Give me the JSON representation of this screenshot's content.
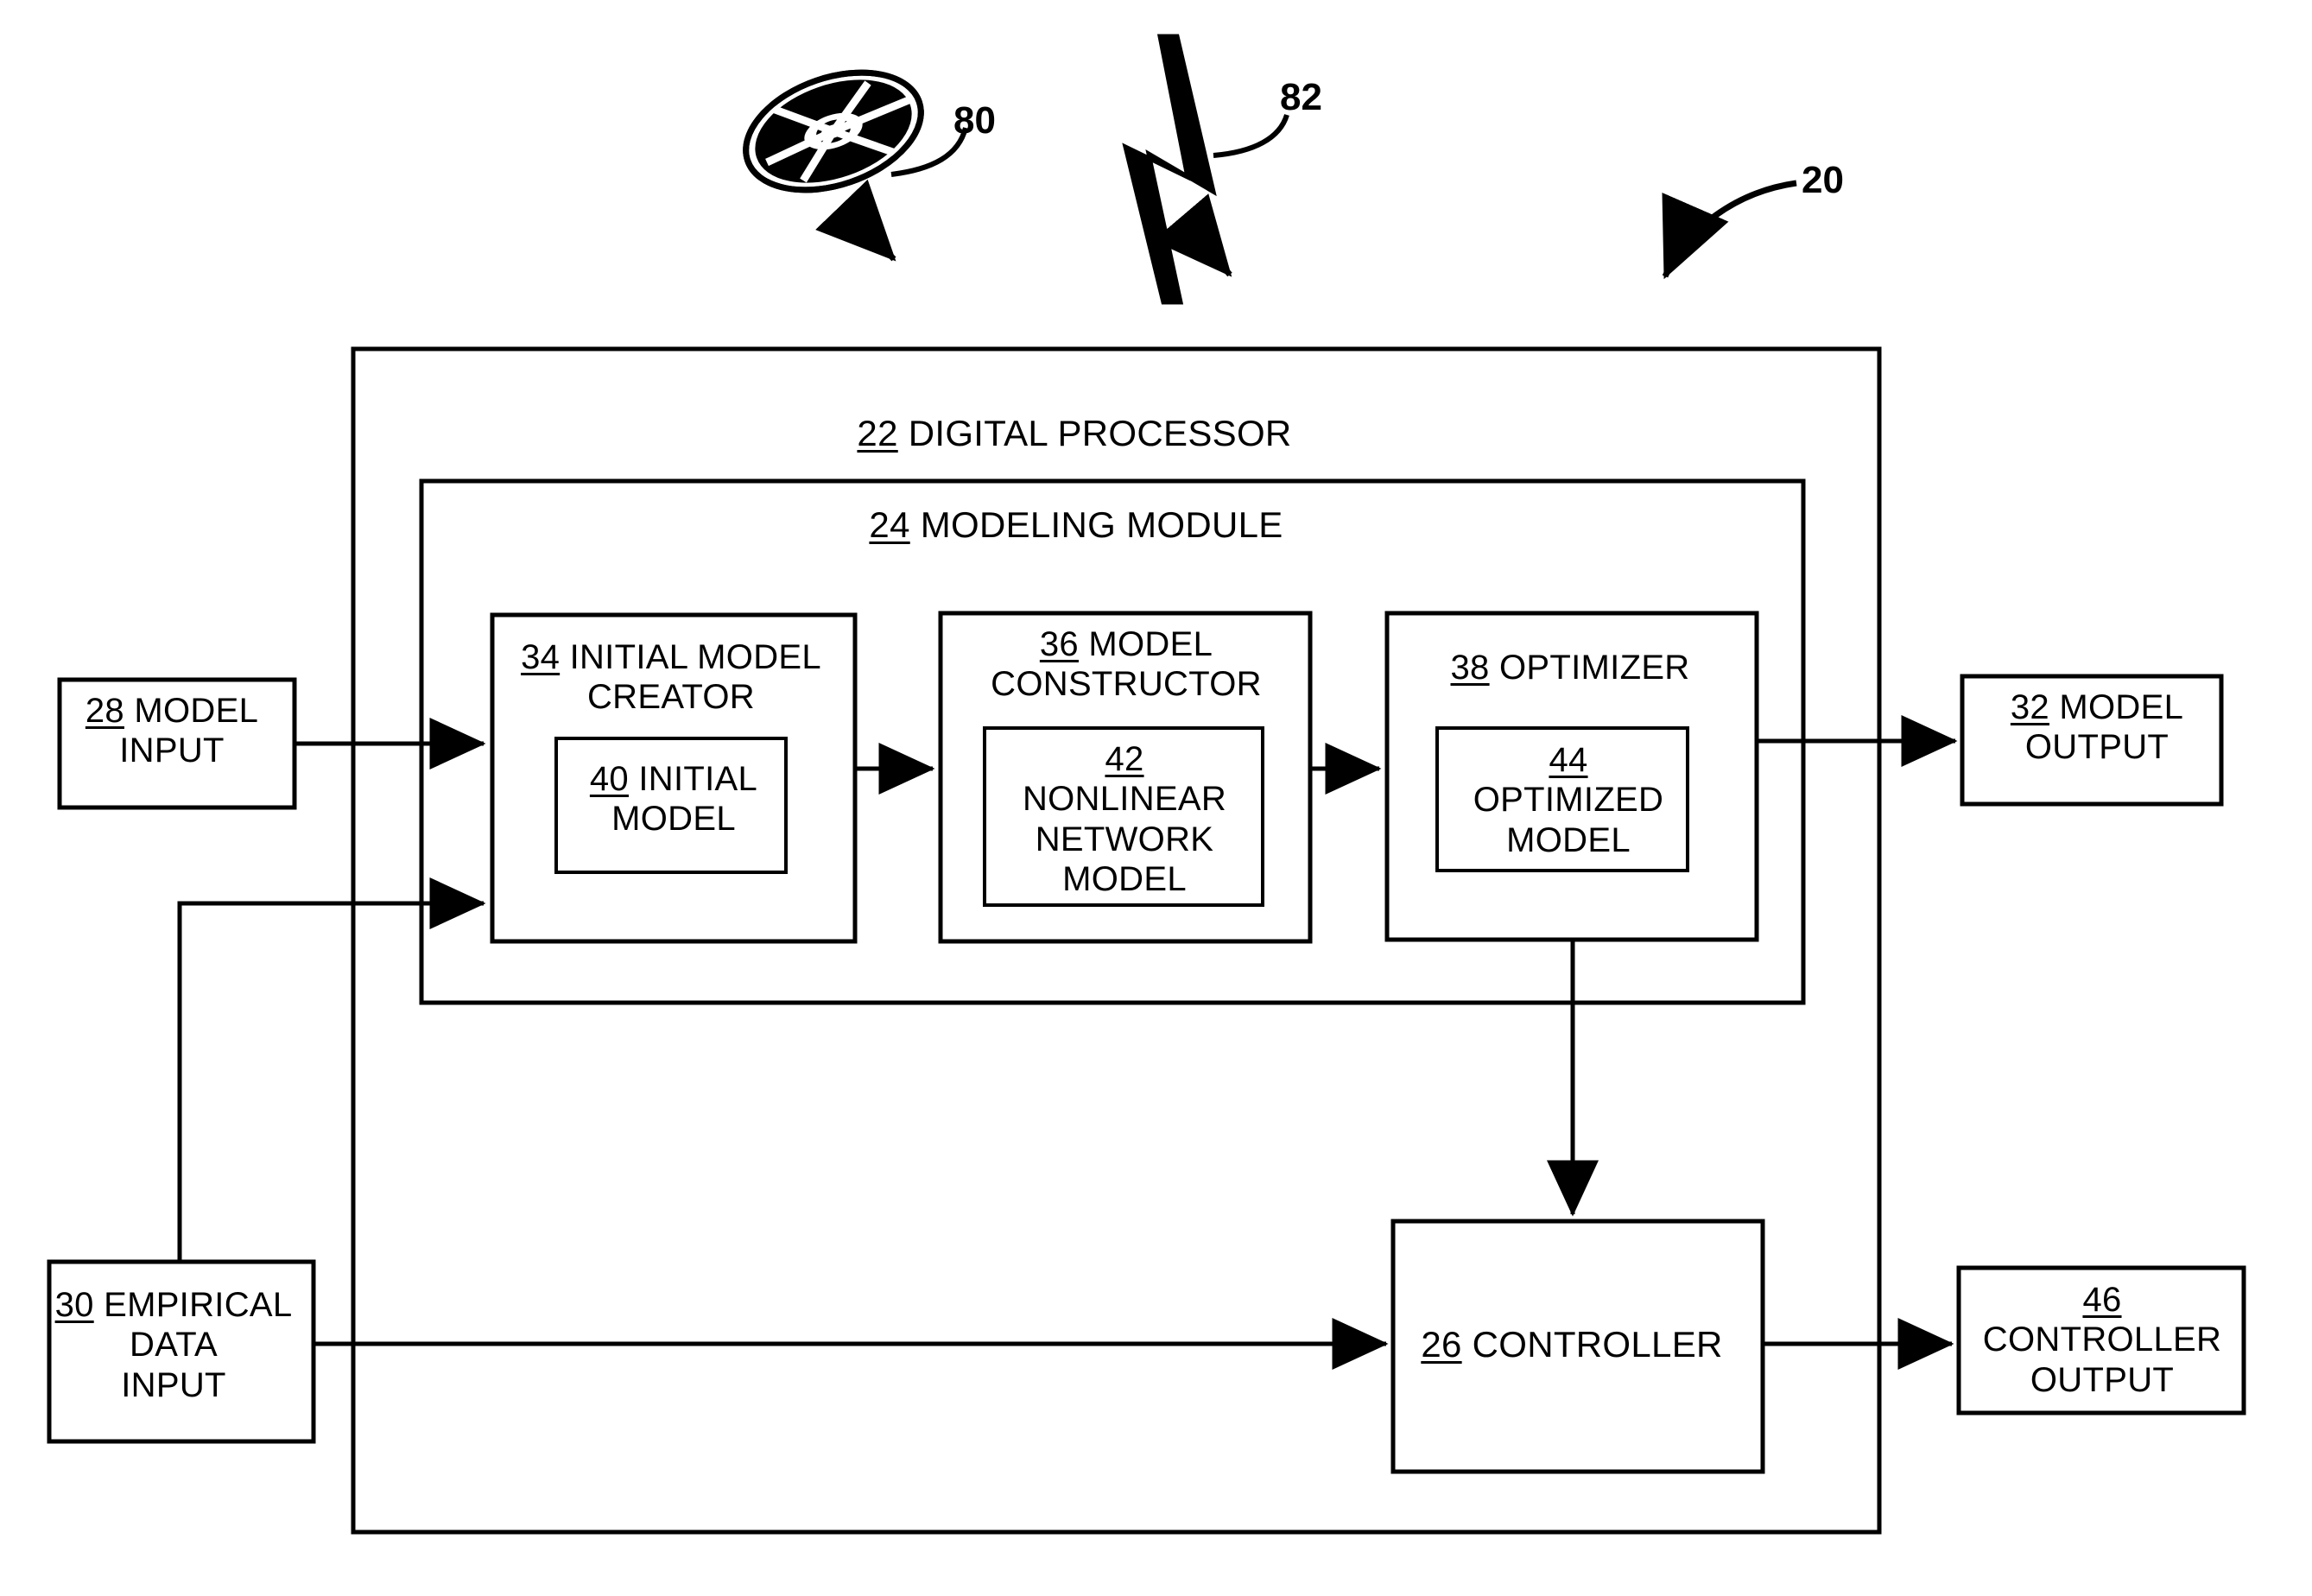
{
  "figure": {
    "title": "Digital processor modeling and control block diagram",
    "callouts": [
      {
        "ref": "80",
        "name": "tape-reel-icon",
        "label": "80"
      },
      {
        "ref": "82",
        "name": "lightning-bolt-icon",
        "label": "82"
      },
      {
        "ref": "20",
        "name": "system-reference",
        "label": "20"
      }
    ]
  },
  "inputs": {
    "model_input": {
      "ref": "28",
      "text": " MODEL\nINPUT"
    },
    "empirical_data_input": {
      "ref": "30",
      "text": " EMPIRICAL\nDATA\nINPUT"
    }
  },
  "outputs": {
    "model_output": {
      "ref": "32",
      "text": " MODEL\nOUTPUT"
    },
    "controller_output": {
      "ref": "46",
      "text": "\nCONTROLLER\nOUTPUT"
    }
  },
  "processor": {
    "ref": "22",
    "text": " DIGITAL PROCESSOR",
    "modeling_module": {
      "ref": "24",
      "text": " MODELING MODULE",
      "stages": [
        {
          "ref": "34",
          "text": " INITIAL MODEL\nCREATOR",
          "inner": {
            "ref": "40",
            "text": " INITIAL\nMODEL"
          }
        },
        {
          "ref": "36",
          "text": " MODEL\nCONSTRUCTOR",
          "inner": {
            "ref": "42",
            "text": "\nNONLINEAR\nNETWORK\nMODEL"
          }
        },
        {
          "ref": "38",
          "text": " OPTIMIZER",
          "inner": {
            "ref": "44",
            "text": "\nOPTIMIZED\nMODEL"
          }
        }
      ]
    },
    "controller": {
      "ref": "26",
      "text": " CONTROLLER"
    }
  },
  "colors": {
    "ink": "#000000",
    "paper": "#ffffff"
  }
}
